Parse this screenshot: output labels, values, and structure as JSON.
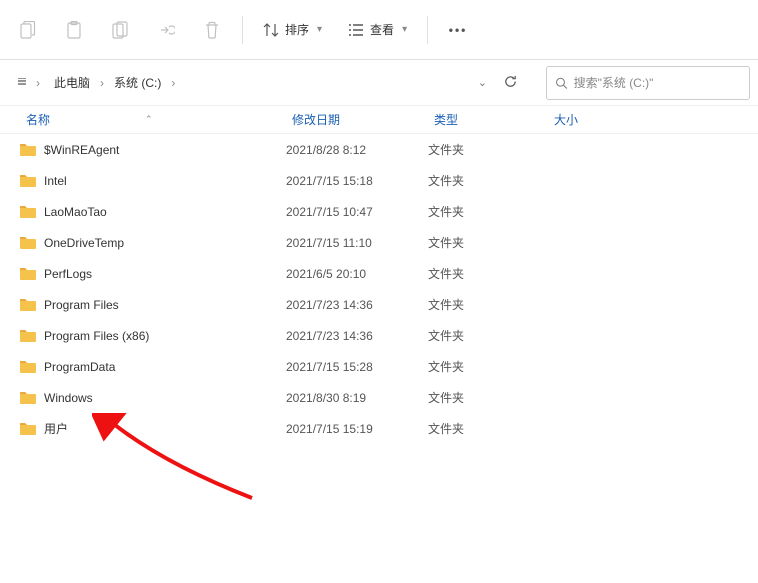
{
  "toolbar": {
    "sort_label": "排序",
    "view_label": "查看"
  },
  "breadcrumb": {
    "items": [
      "此电脑",
      "系统 (C:)"
    ]
  },
  "search": {
    "placeholder": "搜索\"系统 (C:)\""
  },
  "columns": {
    "name": "名称",
    "date": "修改日期",
    "type": "类型",
    "size": "大小"
  },
  "rows": [
    {
      "name": "$WinREAgent",
      "date": "2021/8/28 8:12",
      "type": "文件夹",
      "size": ""
    },
    {
      "name": "Intel",
      "date": "2021/7/15 15:18",
      "type": "文件夹",
      "size": ""
    },
    {
      "name": "LaoMaoTao",
      "date": "2021/7/15 10:47",
      "type": "文件夹",
      "size": ""
    },
    {
      "name": "OneDriveTemp",
      "date": "2021/7/15 11:10",
      "type": "文件夹",
      "size": ""
    },
    {
      "name": "PerfLogs",
      "date": "2021/6/5 20:10",
      "type": "文件夹",
      "size": ""
    },
    {
      "name": "Program Files",
      "date": "2021/7/23 14:36",
      "type": "文件夹",
      "size": ""
    },
    {
      "name": "Program Files (x86)",
      "date": "2021/7/23 14:36",
      "type": "文件夹",
      "size": ""
    },
    {
      "name": "ProgramData",
      "date": "2021/7/15 15:28",
      "type": "文件夹",
      "size": ""
    },
    {
      "name": "Windows",
      "date": "2021/8/30 8:19",
      "type": "文件夹",
      "size": ""
    },
    {
      "name": "用户",
      "date": "2021/7/15 15:19",
      "type": "文件夹",
      "size": ""
    }
  ]
}
